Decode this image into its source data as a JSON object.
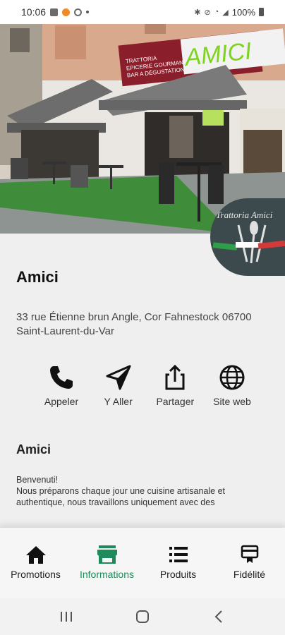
{
  "status_bar": {
    "time": "10:06",
    "battery": "100%"
  },
  "hero": {
    "sign_top": "TRATTORIA",
    "sign_mid": "EPICERIE GOURMANDE",
    "sign_bot": "BAR A DÉGUSTATION",
    "sign_brand": "AMICI"
  },
  "logo": {
    "text": "Trattoria Amici"
  },
  "restaurant": {
    "name": "Amici",
    "address": "33 rue Étienne brun Angle, Cor Fahnestock 06700 Saint-Laurent-du-Var"
  },
  "actions": [
    {
      "label": "Appeler",
      "icon": "phone-icon"
    },
    {
      "label": "Y Aller",
      "icon": "navigation-arrow-icon"
    },
    {
      "label": "Partager",
      "icon": "share-icon"
    },
    {
      "label": "Site web",
      "icon": "globe-icon"
    }
  ],
  "about": {
    "title": "Amici",
    "line1": "Benvenuti!",
    "line2": "Nous préparons chaque jour une cuisine artisanale et authentique, nous travaillons uniquement avec des"
  },
  "bottom_nav": [
    {
      "label": "Promotions",
      "icon": "home-icon",
      "active": false
    },
    {
      "label": "Informations",
      "icon": "store-icon",
      "active": true
    },
    {
      "label": "Produits",
      "icon": "list-icon",
      "active": false
    },
    {
      "label": "Fidélité",
      "icon": "loyalty-card-icon",
      "active": false
    }
  ],
  "colors": {
    "accent": "#1f8a5b",
    "sign_green": "#7ed321",
    "sign_red": "#8b1e2b"
  }
}
